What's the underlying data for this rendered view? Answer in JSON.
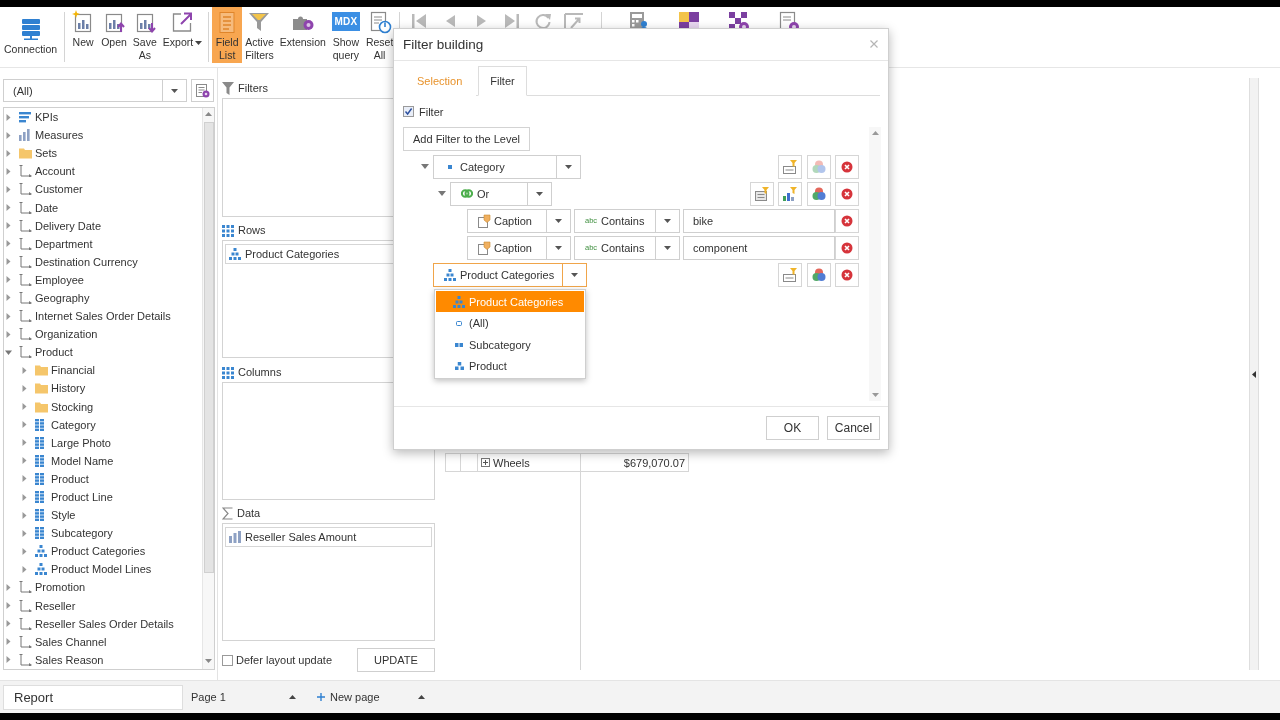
{
  "toolbar": {
    "groups": [
      [
        {
          "label": "Connection",
          "selected": false
        }
      ],
      [
        {
          "label": "New",
          "selected": false
        },
        {
          "label": "Open",
          "selected": false
        },
        {
          "label": "Save As",
          "selected": false
        },
        {
          "label": "Export",
          "selected": false,
          "has_menu": true
        }
      ],
      [
        {
          "label": "Field List",
          "selected": true
        },
        {
          "label": "Active Filters",
          "selected": false
        },
        {
          "label": "Extension",
          "selected": false
        },
        {
          "label": "Show query",
          "selected": false,
          "icon_text": "MDX"
        },
        {
          "label": "Reset All",
          "selected": false
        }
      ]
    ],
    "nav_buttons": [
      {
        "disabled": true
      },
      {
        "disabled": true
      },
      {
        "disabled": true
      },
      {
        "disabled": true
      },
      {
        "disabled": true
      },
      {
        "disabled": true
      }
    ]
  },
  "field_list": {
    "filter_combo": {
      "value": "(All)"
    },
    "tree": [
      {
        "label": "KPIs",
        "kind": "kpi",
        "expanded": false
      },
      {
        "label": "Measures",
        "kind": "measure",
        "expanded": false
      },
      {
        "label": "Sets",
        "kind": "folder",
        "expanded": false
      },
      {
        "label": "Account",
        "kind": "dimension",
        "expanded": false
      },
      {
        "label": "Customer",
        "kind": "dimension",
        "expanded": false
      },
      {
        "label": "Date",
        "kind": "dimension",
        "expanded": false
      },
      {
        "label": "Delivery Date",
        "kind": "dimension",
        "expanded": false
      },
      {
        "label": "Department",
        "kind": "dimension",
        "expanded": false
      },
      {
        "label": "Destination Currency",
        "kind": "dimension",
        "expanded": false
      },
      {
        "label": "Employee",
        "kind": "dimension",
        "expanded": false
      },
      {
        "label": "Geography",
        "kind": "dimension",
        "expanded": false
      },
      {
        "label": "Internet Sales Order Details",
        "kind": "dimension",
        "expanded": false
      },
      {
        "label": "Organization",
        "kind": "dimension",
        "expanded": false
      },
      {
        "label": "Product",
        "kind": "dimension",
        "expanded": true,
        "children": [
          {
            "label": "Financial",
            "kind": "folder",
            "expanded": false
          },
          {
            "label": "History",
            "kind": "folder",
            "expanded": false
          },
          {
            "label": "Stocking",
            "kind": "folder",
            "expanded": false
          },
          {
            "label": "Category",
            "kind": "attribute",
            "expanded": false
          },
          {
            "label": "Large Photo",
            "kind": "attribute",
            "expanded": false
          },
          {
            "label": "Model Name",
            "kind": "attribute",
            "expanded": false
          },
          {
            "label": "Product",
            "kind": "attribute",
            "expanded": false
          },
          {
            "label": "Product Line",
            "kind": "attribute",
            "expanded": false
          },
          {
            "label": "Style",
            "kind": "attribute",
            "expanded": false
          },
          {
            "label": "Subcategory",
            "kind": "attribute",
            "expanded": false
          },
          {
            "label": "Product Categories",
            "kind": "hierarchy",
            "expanded": false
          },
          {
            "label": "Product Model Lines",
            "kind": "hierarchy",
            "expanded": false
          }
        ]
      },
      {
        "label": "Promotion",
        "kind": "dimension",
        "expanded": false
      },
      {
        "label": "Reseller",
        "kind": "dimension",
        "expanded": false
      },
      {
        "label": "Reseller Sales Order Details",
        "kind": "dimension",
        "expanded": false
      },
      {
        "label": "Sales Channel",
        "kind": "dimension",
        "expanded": false
      },
      {
        "label": "Sales Reason",
        "kind": "dimension",
        "expanded": false
      }
    ]
  },
  "layout_panel": {
    "areas": [
      {
        "kind": "filters",
        "title": "Filters"
      },
      {
        "kind": "rows",
        "title": "Rows",
        "items": [
          {
            "label": "Product Categories",
            "kind": "hierarchy"
          }
        ]
      },
      {
        "kind": "columns",
        "title": "Columns"
      },
      {
        "kind": "data",
        "title": "Data",
        "items": [
          {
            "label": "Reseller Sales Amount",
            "kind": "measure"
          }
        ]
      }
    ],
    "defer_update": {
      "label": "Defer layout update",
      "checked": false
    },
    "update_button": "UPDATE"
  },
  "pivot_grid": {
    "rows": [
      {
        "label": "Wheels",
        "value": "$679,070.07",
        "expanded": false
      }
    ]
  },
  "report_bar": {
    "report_name": "Report",
    "pages": [
      {
        "label": "Page 1"
      }
    ],
    "new_page_label": "New page"
  },
  "filter_dialog": {
    "title": "Filter building",
    "tabs": [
      {
        "label": "Selection",
        "selected": false
      },
      {
        "label": "Filter",
        "selected": true
      }
    ],
    "filter_checkbox": {
      "label": "Filter",
      "checked": true
    },
    "add_button": "Add Filter to the Level",
    "rules": [
      {
        "kind": "level",
        "field": {
          "label": "Category",
          "kind": "level"
        },
        "expanded": true,
        "open": false,
        "actions": [
          {
            "kind": "top"
          },
          {
            "kind": "venn",
            "disabled": true
          },
          {
            "kind": "delete"
          }
        ],
        "children": [
          {
            "kind": "group",
            "operator": "Or",
            "expanded": true,
            "actions": [
              {
                "kind": "add"
              },
              {
                "kind": "measure"
              },
              {
                "kind": "venn",
                "disabled": false
              },
              {
                "kind": "delete"
              }
            ],
            "children": [
              {
                "kind": "condition",
                "property": "Caption",
                "comparison": "Contains",
                "value_type": "abc",
                "value": "bike",
                "actions": [
                  {
                    "kind": "delete"
                  }
                ]
              },
              {
                "kind": "condition",
                "property": "Caption",
                "comparison": "Contains",
                "value_type": "abc",
                "value": "component",
                "actions": [
                  {
                    "kind": "delete"
                  }
                ]
              }
            ]
          }
        ]
      },
      {
        "kind": "level",
        "field": {
          "label": "Product Categories",
          "kind": "hierarchy"
        },
        "open": true,
        "options": [
          {
            "label": "Product Categories",
            "kind": "hierarchy",
            "selected": true
          },
          {
            "label": "(All)",
            "kind": "all",
            "selected": false
          },
          {
            "label": "Subcategory",
            "kind": "level",
            "selected": false
          },
          {
            "label": "Product",
            "kind": "level",
            "selected": false
          }
        ],
        "actions": [
          {
            "kind": "top"
          },
          {
            "kind": "venn",
            "disabled": false
          },
          {
            "kind": "delete"
          }
        ]
      }
    ],
    "buttons": [
      "OK",
      "Cancel"
    ]
  }
}
